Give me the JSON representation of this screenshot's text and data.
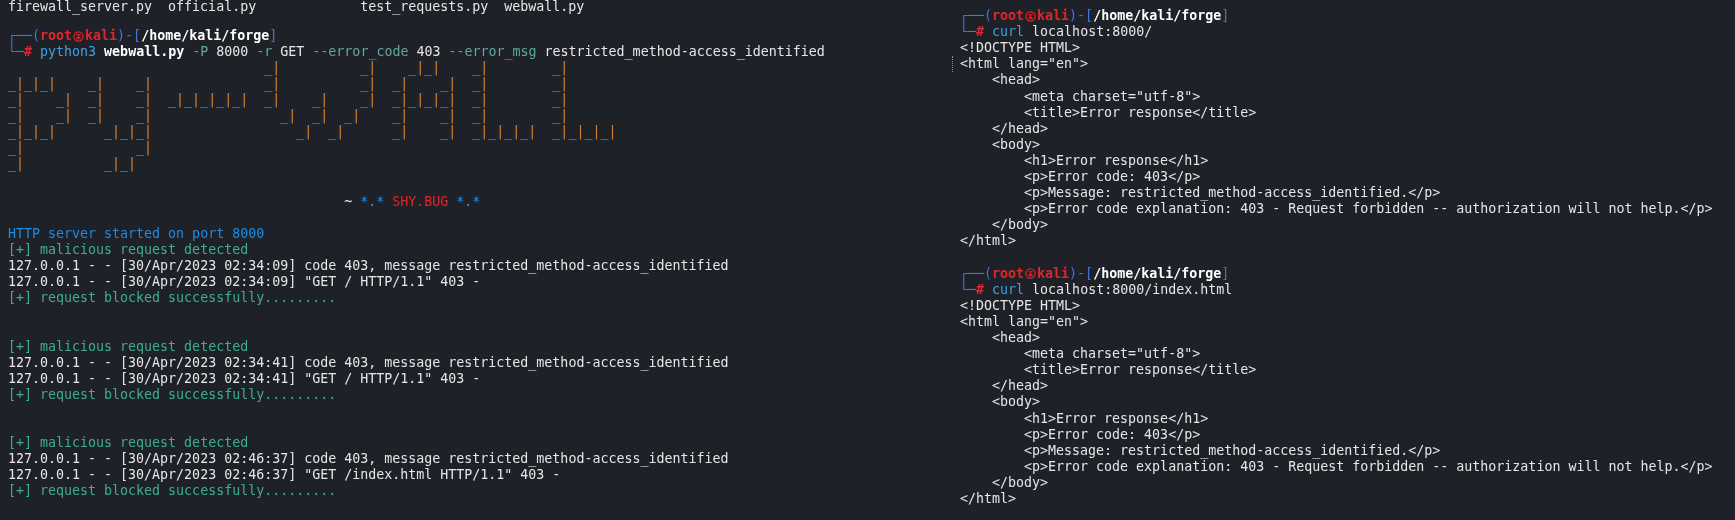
{
  "left_pane": {
    "file_listing": [
      "firewall_server.py",
      "official.py",
      "test_requests.py",
      "webwall.py"
    ],
    "prompt": {
      "frame_open": "┌──(",
      "user": "root",
      "host": "kali",
      "frame_mid": ")-[",
      "path": "/home/kali/forge",
      "frame_close": "]",
      "frame_cmd": "└─",
      "symbol": "#",
      "command": [
        {
          "text": "python3",
          "kind": "program"
        },
        {
          "text": "webwall.py",
          "kind": "file"
        },
        {
          "text": "-P",
          "kind": "option"
        },
        {
          "text": "8000",
          "kind": "arg"
        },
        {
          "text": "-r",
          "kind": "option"
        },
        {
          "text": "GET",
          "kind": "arg"
        },
        {
          "text": "--error_code",
          "kind": "option"
        },
        {
          "text": "403",
          "kind": "arg"
        },
        {
          "text": "--error_msg",
          "kind": "option"
        },
        {
          "text": "restricted_method-access_identified",
          "kind": "arg"
        }
      ]
    },
    "banner": {
      "art": [
        "                                _|          _|    _|_|    _|        _|",
        "_|_|_|    _|    _|              _|          _|  _|    _|  _|        _|",
        "_|    _|  _|    _|  _|_|_|_|_|  _|    _|    _|  _|_|_|_|  _|        _|",
        "_|    _|  _|    _|                _|  _|  _|    _|    _|  _|        _|",
        "_|_|_|      _|_|_|                  _|  _|      _|    _|  _|_|_|_|  _|_|_|_|",
        "_|              _|",
        "_|          _|_|"
      ],
      "tagline": [
        {
          "text": "~",
          "kind": "plain"
        },
        {
          "text": "*.*",
          "kind": "accent"
        },
        {
          "text": "SHY.BUG",
          "kind": "alert"
        },
        {
          "text": "*.*",
          "kind": "accent"
        }
      ]
    },
    "server_message": "HTTP server started on port 8000",
    "requests": [
      {
        "lines": [
          {
            "kind": "status",
            "text": "[+] malicious request detected"
          },
          {
            "kind": "log",
            "text": "127.0.0.1 - - [30/Apr/2023 02:34:09] code 403, message restricted_method-access_identified"
          },
          {
            "kind": "log",
            "text": "127.0.0.1 - - [30/Apr/2023 02:34:09] \"GET / HTTP/1.1\" 403 -"
          },
          {
            "kind": "status",
            "text": "[+] request blocked successfully........."
          }
        ]
      },
      {
        "lines": [
          {
            "kind": "status",
            "text": "[+] malicious request detected"
          },
          {
            "kind": "log",
            "text": "127.0.0.1 - - [30/Apr/2023 02:34:41] code 403, message restricted_method-access_identified"
          },
          {
            "kind": "log",
            "text": "127.0.0.1 - - [30/Apr/2023 02:34:41] \"GET / HTTP/1.1\" 403 -"
          },
          {
            "kind": "status",
            "text": "[+] request blocked successfully........."
          }
        ]
      },
      {
        "lines": [
          {
            "kind": "status",
            "text": "[+] malicious request detected"
          },
          {
            "kind": "log",
            "text": "127.0.0.1 - - [30/Apr/2023 02:46:37] code 403, message restricted_method-access_identified"
          },
          {
            "kind": "log",
            "text": "127.0.0.1 - - [30/Apr/2023 02:46:37] \"GET /index.html HTTP/1.1\" 403 -"
          },
          {
            "kind": "status",
            "text": "[+] request blocked successfully........."
          }
        ]
      }
    ]
  },
  "right_pane": {
    "sessions": [
      {
        "prompt": {
          "frame_open": "┌──(",
          "user": "root",
          "host": "kali",
          "frame_mid": ")-[",
          "path": "/home/kali/forge",
          "frame_close": "]",
          "frame_cmd": "└─",
          "symbol": "#",
          "command": [
            {
              "text": "curl",
              "kind": "program"
            },
            {
              "text": "localhost:8000/",
              "kind": "arg"
            }
          ]
        },
        "output": [
          {
            "text": "<!DOCTYPE HTML>",
            "marked": false
          },
          {
            "text": "<html lang=\"en\">",
            "marked": true,
            "children": [
              {
                "text": "<head>",
                "children": [
                  {
                    "text": "<meta charset=\"utf-8\">"
                  },
                  {
                    "text": "<title>Error response</title>"
                  }
                ]
              },
              {
                "text": "</head>"
              },
              {
                "text": "<body>",
                "children": [
                  {
                    "text": "<h1>Error response</h1>"
                  },
                  {
                    "text": "<p>Error code: 403</p>"
                  },
                  {
                    "text": "<p>Message: restricted_method-access_identified.</p>"
                  },
                  {
                    "text": "<p>Error code explanation: 403 - Request forbidden -- authorization will not help.</p>"
                  }
                ]
              },
              {
                "text": "</body>"
              }
            ]
          },
          {
            "text": "</html>",
            "marked": false
          }
        ]
      },
      {
        "prompt": {
          "frame_open": "┌──(",
          "user": "root",
          "host": "kali",
          "frame_mid": ")-[",
          "path": "/home/kali/forge",
          "frame_close": "]",
          "frame_cmd": "└─",
          "symbol": "#",
          "command": [
            {
              "text": "curl",
              "kind": "program"
            },
            {
              "text": "localhost:8000/index.html",
              "kind": "arg"
            }
          ]
        },
        "output": [
          {
            "text": "<!DOCTYPE HTML>",
            "marked": false
          },
          {
            "text": "<html lang=\"en\">",
            "marked": false,
            "children": [
              {
                "text": "<head>",
                "children": [
                  {
                    "text": "<meta charset=\"utf-8\">"
                  },
                  {
                    "text": "<title>Error response</title>"
                  }
                ]
              },
              {
                "text": "</head>"
              },
              {
                "text": "<body>",
                "children": [
                  {
                    "text": "<h1>Error response</h1>"
                  },
                  {
                    "text": "<p>Error code: 403</p>"
                  },
                  {
                    "text": "<p>Message: restricted_method-access_identified.</p>"
                  },
                  {
                    "text": "<p>Error code explanation: 403 - Request forbidden -- authorization will not help.</p>"
                  }
                ]
              },
              {
                "text": "</body>"
              }
            ]
          },
          {
            "text": "</html>",
            "marked": false
          }
        ]
      }
    ]
  }
}
